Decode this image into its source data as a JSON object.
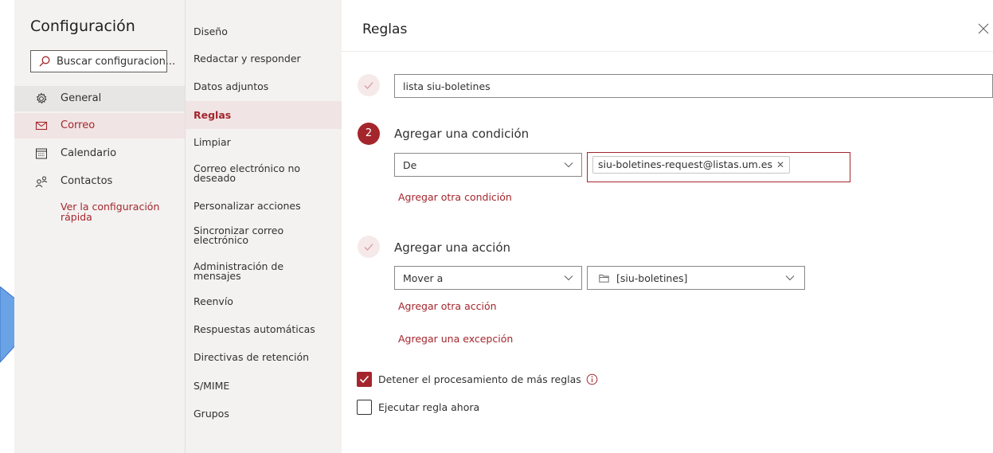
{
  "settings": {
    "title": "Configuración",
    "search_placeholder": "Buscar configuracion...",
    "nav": [
      {
        "label": "General",
        "icon": "gear-icon"
      },
      {
        "label": "Correo",
        "icon": "mail-icon"
      },
      {
        "label": "Calendario",
        "icon": "calendar-icon"
      },
      {
        "label": "Contactos",
        "icon": "people-icon"
      }
    ],
    "quick_settings": "Ver la configuración rápida"
  },
  "mail_menu": [
    "Diseño",
    "Redactar y responder",
    "Datos adjuntos",
    "Reglas",
    "Limpiar",
    "Correo electrónico no deseado",
    "Personalizar acciones",
    "Sincronizar correo electrónico",
    "Administración de mensajes",
    "Reenvío",
    "Respuestas automáticas",
    "Directivas de retención",
    "S/MIME",
    "Grupos"
  ],
  "rules": {
    "title": "Reglas",
    "rule_name": "lista siu-boletines",
    "condition_step": "2",
    "condition_heading": "Agregar una condición",
    "condition_field": "De",
    "condition_value": "siu-boletines-request@listas.um.es",
    "add_condition": "Agregar otra condición",
    "action_heading": "Agregar una acción",
    "action_field": "Mover a",
    "action_target": "[siu-boletines]",
    "add_action": "Agregar otra acción",
    "add_exception": "Agregar una excepción",
    "stop_processing": "Detener el procesamiento de más reglas",
    "stop_processing_checked": true,
    "run_now": "Ejecutar regla ahora",
    "run_now_checked": false
  },
  "colors": {
    "accent": "#a4262c",
    "accent_light": "#f1e4e4",
    "sidebar_bg": "#f3f2f1"
  }
}
